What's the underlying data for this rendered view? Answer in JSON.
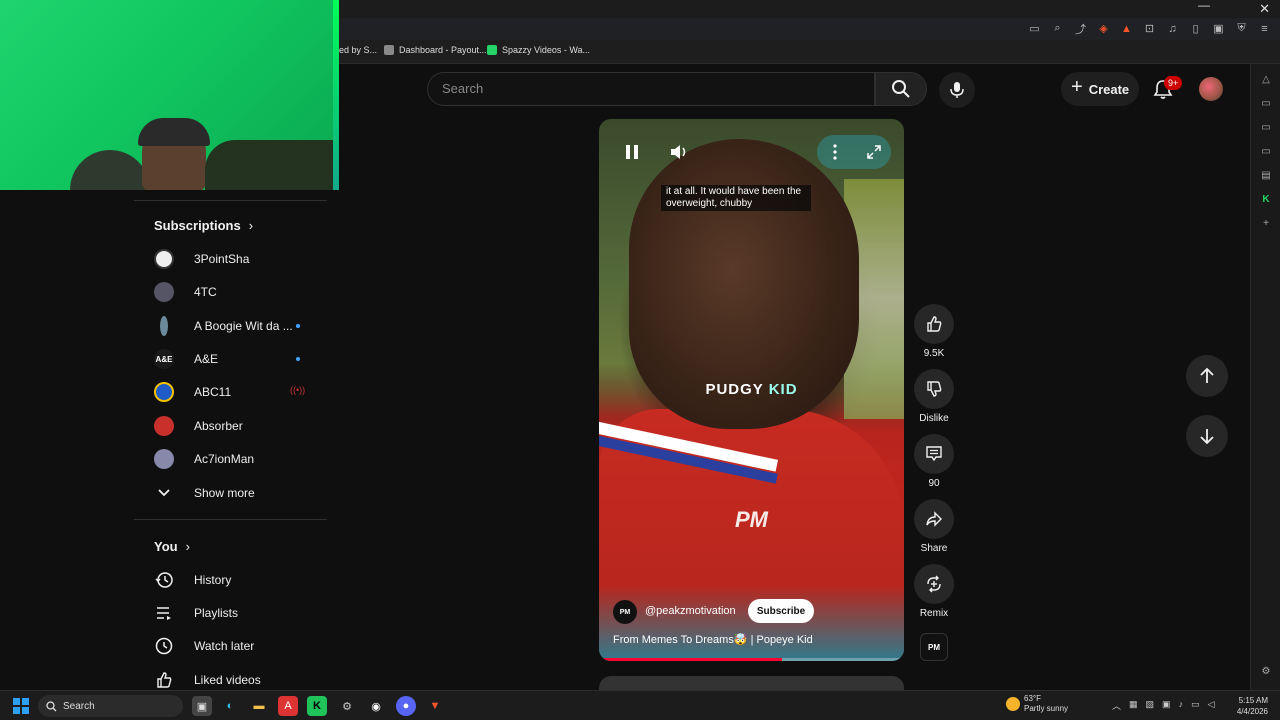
{
  "bookmarks": [
    {
      "label": "ed by S..."
    },
    {
      "label": "Dashboard - Payout..."
    },
    {
      "label": "Spazzy Videos - Wa..."
    }
  ],
  "header": {
    "search_placeholder": "Search",
    "create_label": "Create",
    "notification_badge": "9+"
  },
  "guide": {
    "subscriptions_title": "Subscriptions",
    "channels": [
      {
        "name": "3PointSha",
        "avatar_color": "#eeeeee",
        "indicator": ""
      },
      {
        "name": "4TC",
        "avatar_color": "#555566",
        "indicator": ""
      },
      {
        "name": "A Boogie Wit da ...",
        "avatar_color": "#6a8a9a",
        "indicator": "new"
      },
      {
        "name": "A&E",
        "avatar_color": "#1a1a1a",
        "indicator": "new"
      },
      {
        "name": "ABC11",
        "avatar_color": "#1e5bc6",
        "indicator": "live"
      },
      {
        "name": "Absorber",
        "avatar_color": "#c8302c",
        "indicator": ""
      },
      {
        "name": "Ac7ionMan",
        "avatar_color": "#8888aa",
        "indicator": ""
      }
    ],
    "show_more_label": "Show more",
    "you_title": "You",
    "you_items": [
      {
        "label": "History",
        "icon": "history-icon"
      },
      {
        "label": "Playlists",
        "icon": "playlists-icon"
      },
      {
        "label": "Watch later",
        "icon": "watch-later-icon"
      },
      {
        "label": "Liked videos",
        "icon": "liked-videos-icon"
      }
    ]
  },
  "player": {
    "caption": "it at all. It would have been the overweight, chubby",
    "overlay_word1": "PUDGY",
    "overlay_word2": "KID",
    "watermark": "PM",
    "channel_avatar_text": "PM",
    "channel_handle": "@peakzmotivation",
    "subscribe_label": "Subscribe",
    "title": "From Memes To Dreams🤯 | Popeye Kid",
    "progress_fraction": 0.6
  },
  "actions": {
    "likes": "9.5K",
    "dislike_label": "Dislike",
    "comments": "90",
    "share_label": "Share",
    "remix_label": "Remix",
    "audio_badge": "PM"
  },
  "taskbar": {
    "search_label": "Search",
    "weather_temp": "63°F",
    "weather_desc": "Partly sunny",
    "time": "5:15 AM",
    "date": "4/4/2026"
  },
  "colors": {
    "accent_red": "#ff0033",
    "badge_red": "#cc0000",
    "new_dot": "#3ea6ff",
    "webcam_green": "#11c860"
  }
}
